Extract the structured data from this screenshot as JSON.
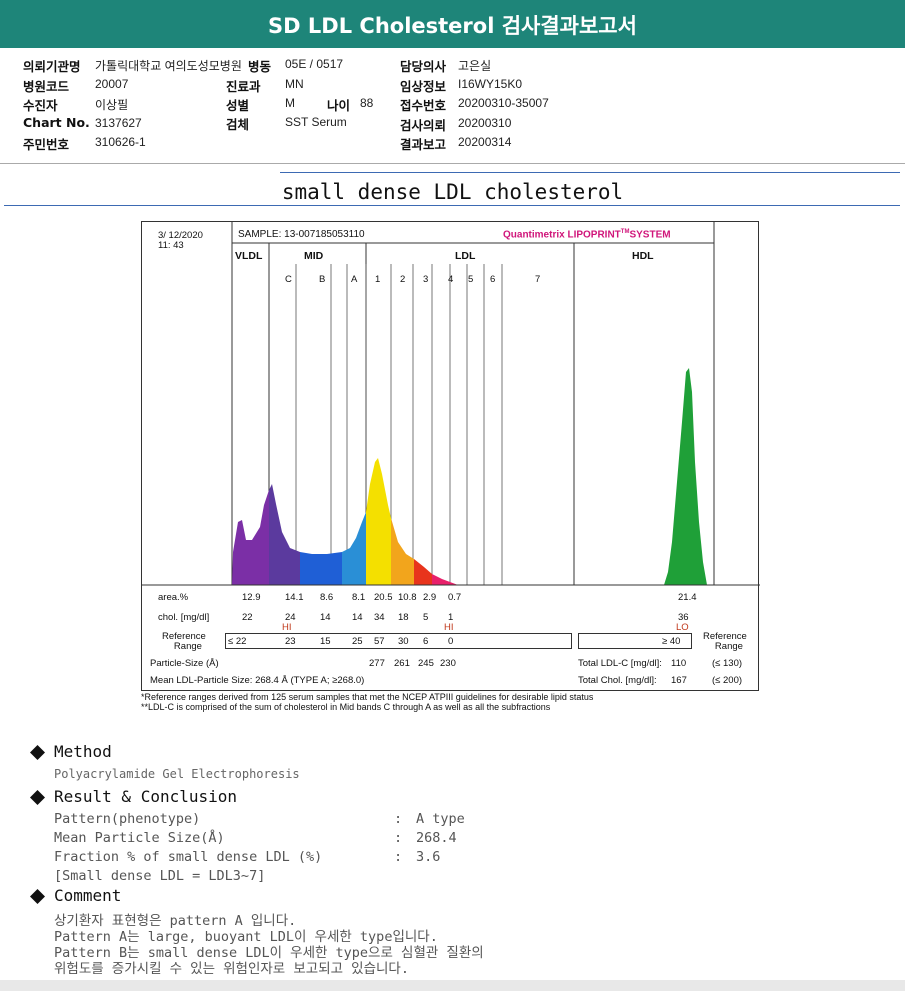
{
  "header": {
    "title": "SD LDL Cholesterol 검사결과보고서"
  },
  "info": {
    "hospital_label": "의뢰기관명",
    "hospital_value": "가톨릭대학교 여의도성모병원",
    "ward_label": "병동",
    "ward_value": "05E / 0517",
    "doctor_label": "담당의사",
    "doctor_value": "고은실",
    "code_label": "병원코드",
    "code_value": "20007",
    "dept_label": "진료과",
    "dept_value": "MN",
    "clinical_label": "임상정보",
    "clinical_value": "I16WY15K0",
    "patient_label": "수진자",
    "patient_value": "이상필",
    "sex_label": "성별",
    "sex_value": "M",
    "age_label": "나이",
    "age_value": "88",
    "receipt_label": "접수번호",
    "receipt_value": "20200310-35007",
    "chart_label": "Chart No.",
    "chart_value": "3137627",
    "specimen_label": "검체",
    "specimen_value": "SST Serum",
    "request_label": "검사의뢰",
    "request_value": "20200310",
    "id_label": "주민번호",
    "id_value": "310626-1",
    "report_label": "결과보고",
    "report_value": "20200314"
  },
  "section_title": "small dense LDL cholesterol",
  "report": {
    "date": "3/ 12/2020",
    "time": "11: 43",
    "sample": "SAMPLE:   13-007185053110",
    "brand": "Quantimetrix LIPOPRINT",
    "brand_tm": "TM",
    "brand_suffix": "SYSTEM",
    "groups": [
      "VLDL",
      "MID",
      "LDL",
      "HDL"
    ],
    "bands": [
      "C",
      "B",
      "A",
      "1",
      "2",
      "3",
      "4",
      "5",
      "6",
      "7"
    ],
    "area_label": "area.%",
    "area_values": [
      "12.9",
      "14.1",
      "8.6",
      "8.1",
      "20.5",
      "10.8",
      "2.9",
      "0.7",
      "21.4"
    ],
    "chol_label": "chol. [mg/dl]",
    "chol_values": [
      "22",
      "24",
      "14",
      "14",
      "34",
      "18",
      "5",
      "1",
      "36"
    ],
    "flags": [
      "HI",
      "HI",
      "LO"
    ],
    "ref_label": "Reference\nRange",
    "ref_label_line1": "Reference",
    "ref_label_line2": "Range",
    "ref_values": [
      "≤ 22",
      "23",
      "15",
      "25",
      "57",
      "30",
      "6",
      "0"
    ],
    "ref_hdl": "≥ 40",
    "particle_label": "Particle-Size (Å)",
    "particle_values": [
      "277",
      "261",
      "245",
      "230"
    ],
    "mean_label": "Mean LDL-Particle Size:   268.4 Å   (TYPE A; ≥268.0)",
    "total_ldl_label": "Total LDL-C [mg/dl]:",
    "total_ldl_value": "110",
    "total_ldl_ref": "(≤ 130)",
    "total_chol_label": "Total Chol. [mg/dl]:",
    "total_chol_value": "167",
    "total_chol_ref": "(≤ 200)"
  },
  "footnotes": {
    "line1": "*Reference ranges derived from 125 serum samples that met the NCEP ATPIII guidelines for desirable lipid status",
    "line2": "**LDL-C is comprised of the sum of cholesterol in Mid bands C through A as well as all the subfractions"
  },
  "method": {
    "heading": "Method",
    "text": "Polyacrylamide Gel Electrophoresis"
  },
  "result": {
    "heading": "Result & Conclusion",
    "rows": [
      {
        "label": "Pattern(phenotype)",
        "sep": ":",
        "value": "A type"
      },
      {
        "label": "Mean Particle Size(Å)",
        "sep": ":",
        "value": "268.4"
      },
      {
        "label": "Fraction % of small dense LDL (%)",
        "sep": ":",
        "value": "3.6"
      }
    ],
    "note": "[Small dense LDL = LDL3~7]"
  },
  "comment": {
    "heading": "Comment",
    "lines": [
      "상기환자 표현형은 pattern A 입니다.",
      "Pattern A는 large, buoyant LDL이 우세한 type입니다.",
      "Pattern B는 small dense LDL이 우세한 type으로 심혈관 질환의",
      "위험도를 증가시킬 수 있는 위험인자로 보고되고 있습니다."
    ]
  },
  "colors": {
    "header_bg": "#1e8579",
    "brand": "#d0157a",
    "flag": "#c0391b",
    "rule": "#3d6ab3",
    "vldl": "#7b2fa6",
    "mid_c": "#5b3a9e",
    "mid_b": "#1f5fd6",
    "mid_a": "#2a8fd6",
    "ldl1": "#f4e000",
    "ldl2": "#f2a51c",
    "ldl3": "#e8341c",
    "ldl4": "#e8206a",
    "hdl": "#1fa038"
  }
}
